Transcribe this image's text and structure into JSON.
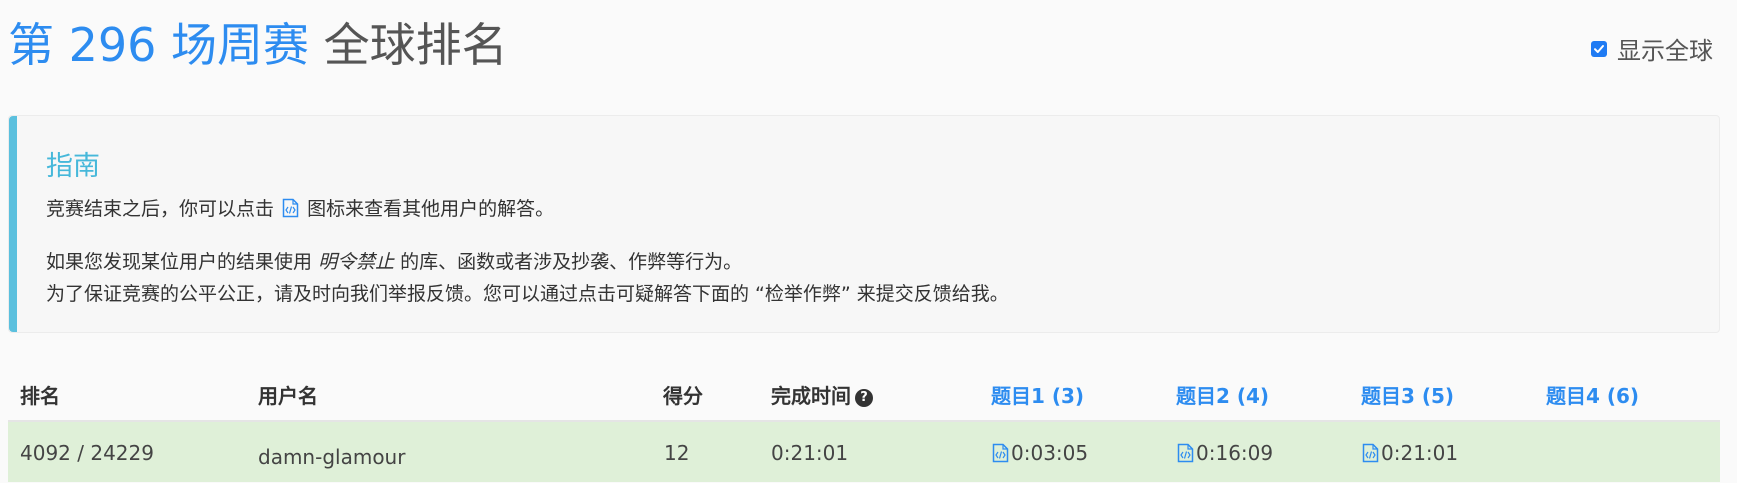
{
  "header": {
    "title_accent": "第 296 场周赛",
    "title_rest": "全球排名",
    "show_global_label": "显示全球",
    "show_global_checked": true
  },
  "guide": {
    "title": "指南",
    "line1_before": "竞赛结束之后，你可以点击",
    "line1_after": "图标来查看其他用户的解答。",
    "line2_before": "如果您发现某位用户的结果使用",
    "line2_em": "明令禁止",
    "line2_after": "的库、函数或者涉及抄袭、作弊等行为。",
    "line3": "为了保证竞赛的公平公正，请及时向我们举报反馈。您可以通过点击可疑解答下面的 “检举作弊” 来提交反馈给我。"
  },
  "table": {
    "headers": {
      "rank": "排名",
      "username": "用户名",
      "score": "得分",
      "finish_time": "完成时间",
      "q1": "题目1 (3)",
      "q2": "题目2 (4)",
      "q3": "题目3 (5)",
      "q4": "题目4 (6)"
    },
    "rows": [
      {
        "rank": "4092 / 24229",
        "username": "damn-glamour",
        "score": "12",
        "finish_time": "0:21:01",
        "q1": "0:03:05",
        "q2": "0:16:09",
        "q3": "0:21:01",
        "q4": ""
      }
    ]
  },
  "colors": {
    "accent": "#2d8cf0",
    "guide_title": "#46b8da",
    "guide_bar": "#5bc0de",
    "row_bg": "#dff0d8"
  },
  "icons": {
    "code": "code-file-icon",
    "help": "question-circle-icon",
    "check": "check-icon"
  }
}
